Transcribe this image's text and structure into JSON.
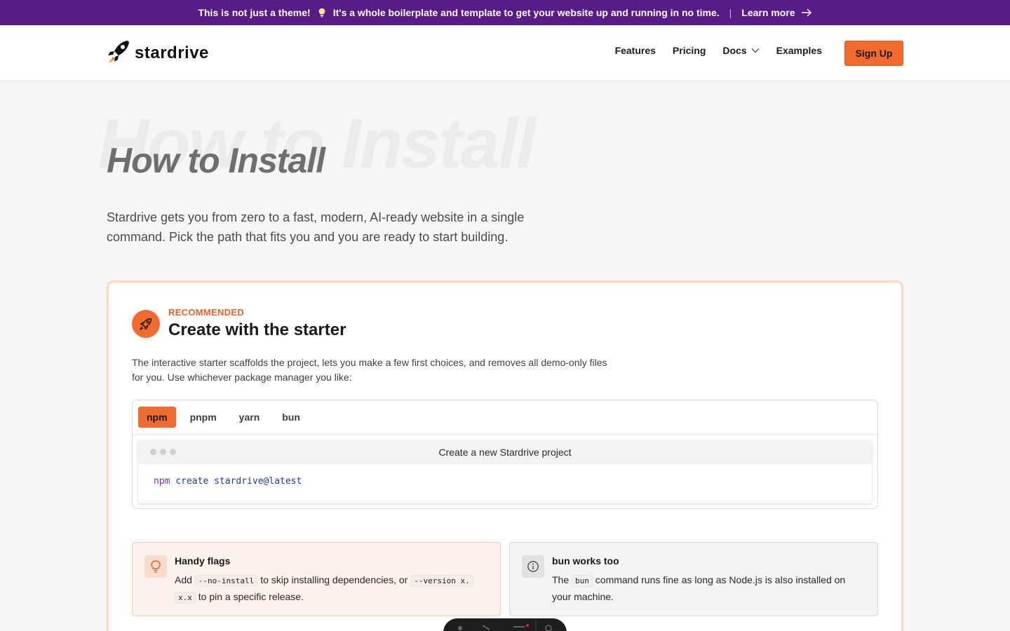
{
  "announcement": {
    "text_before": "This is not just a theme!",
    "text_after": "It's a whole boilerplate and template to get your website up and running in no time.",
    "separator": "|",
    "link_label": "Learn more",
    "bulb_icon": "lightbulb-icon",
    "arrow_icon": "arrow-right-icon"
  },
  "header": {
    "logo_text": "stardrive",
    "logo_icon": "rocket-icon",
    "nav": {
      "features": "Features",
      "pricing": "Pricing",
      "docs": "Docs",
      "examples": "Examples"
    },
    "signup_label": "Sign Up"
  },
  "hero": {
    "ghost_title": "How to Install",
    "title": "How to Install",
    "intro": "Stardrive gets you from zero to a fast, modern, AI-ready website in a single command. Pick the path that fits you and you are ready to start building."
  },
  "card": {
    "eyebrow": "RECOMMENDED",
    "title": "Create with the starter",
    "description": "The interactive starter scaffolds the project, lets you make a few first choices, and removes all demo-only files for you. Use whichever package manager you like:",
    "tabs": {
      "npm": "npm",
      "pnpm": "pnpm",
      "yarn": "yarn",
      "bun": "bun"
    },
    "active_tab": "npm",
    "terminal": {
      "title": "Create a new Stardrive project",
      "command_bin": "npm",
      "command_rest": "create stardrive@latest"
    }
  },
  "notes": {
    "flags": {
      "title": "Handy flags",
      "text1": "Add",
      "code1": "--no-install",
      "text2": "to skip installing dependencies, or",
      "code2a": "--version x.",
      "code2b": "x.x",
      "text3": "to pin a specific release."
    },
    "bun": {
      "title": "bun works too",
      "text1": "The",
      "code": "bun",
      "text2": "command runs fine as long as Node.js is also installed on your machine."
    }
  },
  "colors": {
    "announce_bg": "#581c87",
    "accent": "#f26a2e",
    "card_border": "#fbd8c8"
  }
}
